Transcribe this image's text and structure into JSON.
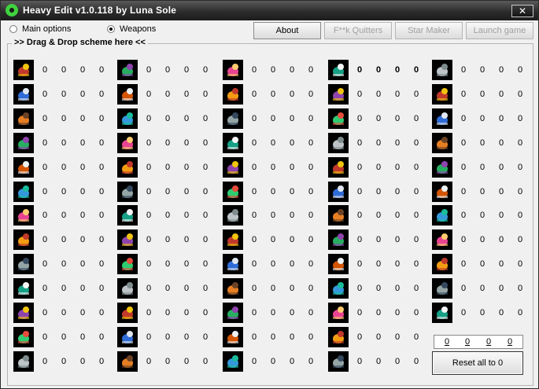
{
  "window": {
    "title": "Heavy Edit v1.0.118 by Luna Sole",
    "close_label": "✕"
  },
  "options": [
    {
      "label": "Main options",
      "selected": false
    },
    {
      "label": "Weapons",
      "selected": true
    }
  ],
  "toolbar": [
    {
      "label": "About",
      "enabled": true
    },
    {
      "label": "F**k Quitters",
      "enabled": false
    },
    {
      "label": "Star Maker",
      "enabled": false
    },
    {
      "label": "Launch game",
      "enabled": false
    }
  ],
  "group_label": ">> Drag & Drop scheme here <<",
  "columns": [
    {
      "rows": [
        {
          "icon": "dynamite-icon",
          "values": [
            "0",
            "0",
            "0",
            "0"
          ]
        },
        {
          "icon": "rocket-jet-icon",
          "values": [
            "0",
            "0",
            "0",
            "0"
          ]
        },
        {
          "icon": "grenade-icon",
          "values": [
            "0",
            "0",
            "0",
            "0"
          ]
        },
        {
          "icon": "banana-bottle-icon",
          "values": [
            "0",
            "0",
            "0",
            "0"
          ]
        },
        {
          "icon": "holy-grenade-icon",
          "values": [
            "0",
            "0",
            "0",
            "0"
          ]
        },
        {
          "icon": "ninja-rope-icon",
          "values": [
            "0",
            "0",
            "0",
            "0"
          ]
        },
        {
          "icon": "petrol-bomb-icon",
          "values": [
            "0",
            "0",
            "0",
            "0"
          ]
        },
        {
          "icon": "banana-icon",
          "values": [
            "0",
            "0",
            "0",
            "0"
          ]
        },
        {
          "icon": "handgun-icon",
          "values": [
            "0",
            "0",
            "0",
            "0"
          ]
        },
        {
          "icon": "uzi-icon",
          "values": [
            "0",
            "0",
            "0",
            "0"
          ]
        },
        {
          "icon": "minigun-icon",
          "values": [
            "0",
            "0",
            "0",
            "0"
          ]
        },
        {
          "icon": "laser-gun-icon",
          "values": [
            "0",
            "0",
            "0",
            "0"
          ]
        },
        {
          "icon": "longbow-icon",
          "values": [
            "0",
            "0",
            "0",
            "0"
          ]
        }
      ]
    },
    {
      "rows": [
        {
          "icon": "missiles-icon",
          "values": [
            "0",
            "0",
            "0",
            "0"
          ]
        },
        {
          "icon": "fire-icon",
          "values": [
            "0",
            "0",
            "0",
            "0"
          ]
        },
        {
          "icon": "mine-icon",
          "values": [
            "0",
            "0",
            "0",
            "0"
          ]
        },
        {
          "icon": "worm-bandana-icon",
          "values": [
            "0",
            "0",
            "0",
            "0"
          ]
        },
        {
          "icon": "kamikaze-worm-icon",
          "values": [
            "0",
            "0",
            "0",
            "0"
          ]
        },
        {
          "icon": "explosion-icon",
          "values": [
            "0",
            "0",
            "0",
            "0"
          ]
        },
        {
          "icon": "sausage-icon",
          "values": [
            "0",
            "0",
            "0",
            "0"
          ]
        },
        {
          "icon": "axe-icon",
          "values": [
            "0",
            "0",
            "0",
            "0"
          ]
        },
        {
          "icon": "robot-icon",
          "values": [
            "0",
            "0",
            "0",
            "0"
          ]
        },
        {
          "icon": "drill-icon",
          "values": [
            "0",
            "0",
            "0",
            "0"
          ]
        },
        {
          "icon": "girder-icon",
          "values": [
            "0",
            "0",
            "0",
            "0"
          ]
        },
        {
          "icon": "coil-icon",
          "values": [
            "0",
            "0",
            "0",
            "0"
          ]
        },
        {
          "icon": "parachute-icon",
          "values": [
            "0",
            "0",
            "0",
            "0"
          ]
        }
      ]
    },
    {
      "rows": [
        {
          "icon": "bottle-worm-icon",
          "values": [
            "0",
            "0",
            "0",
            "0"
          ]
        },
        {
          "icon": "battery-icon",
          "values": [
            "0",
            "0",
            "0",
            "0"
          ]
        },
        {
          "icon": "dynamite-stick-icon",
          "values": [
            "0",
            "0",
            "0",
            "0"
          ]
        },
        {
          "icon": "sheep-icon",
          "values": [
            "0",
            "0",
            "0",
            "0"
          ]
        },
        {
          "icon": "blowtorch-icon",
          "values": [
            "0",
            "0",
            "0",
            "0"
          ]
        },
        {
          "icon": "firestorm-icon",
          "values": [
            "0",
            "0",
            "0",
            "0"
          ]
        },
        {
          "icon": "purple-bird-icon",
          "values": [
            "0",
            "0",
            "0",
            "0"
          ]
        },
        {
          "icon": "cow-icon",
          "values": [
            "0",
            "0",
            "0",
            "0"
          ]
        },
        {
          "icon": "potion-icon",
          "values": [
            "0",
            "0",
            "0",
            "0"
          ]
        },
        {
          "icon": "old-woman-icon",
          "values": [
            "0",
            "0",
            "0",
            "0"
          ]
        },
        {
          "icon": "cloud-angel-icon",
          "values": [
            "0",
            "0",
            "0",
            "0"
          ]
        },
        {
          "icon": "airplane-icon",
          "values": [
            "0",
            "0",
            "0",
            "0"
          ]
        },
        {
          "icon": "mole-icon",
          "values": [
            "0",
            "0",
            "0",
            "0"
          ]
        }
      ]
    },
    {
      "rows": [
        {
          "icon": "worm-icon",
          "values": [
            "0",
            "0",
            "0",
            "0"
          ],
          "bold": true
        },
        {
          "icon": "ring-icon",
          "values": [
            "0",
            "0",
            "0",
            "0"
          ]
        },
        {
          "icon": "crosshair-wheel-icon",
          "values": [
            "0",
            "0",
            "0",
            "0"
          ]
        },
        {
          "icon": "worm-face-icon",
          "values": [
            "0",
            "0",
            "0",
            "0"
          ]
        },
        {
          "icon": "ghost-worm-icon",
          "values": [
            "0",
            "0",
            "0",
            "0"
          ]
        },
        {
          "icon": "ice-cube-icon",
          "values": [
            "0",
            "0",
            "0",
            "0"
          ]
        },
        {
          "icon": "banana-bomb-icon",
          "values": [
            "0",
            "0",
            "0",
            "0"
          ]
        },
        {
          "icon": "green-worm-icon",
          "values": [
            "0",
            "0",
            "0",
            "0"
          ]
        },
        {
          "icon": "stripes-icon",
          "values": [
            "0",
            "0",
            "0",
            "0"
          ]
        },
        {
          "icon": "landscape-icon",
          "values": [
            "0",
            "0",
            "0",
            "0"
          ]
        },
        {
          "icon": "scales-icon",
          "values": [
            "0",
            "0",
            "0",
            "0"
          ]
        },
        {
          "icon": "vase-icon",
          "values": [
            "0",
            "0",
            "0",
            "0"
          ]
        },
        {
          "icon": "red-pipes-icon",
          "values": [
            "0",
            "0",
            "0",
            "0"
          ]
        }
      ]
    },
    {
      "rows": [
        {
          "icon": "bullet-icon",
          "values": [
            "0",
            "0",
            "0",
            "0"
          ]
        },
        {
          "icon": "castle-icon",
          "values": [
            "0",
            "0",
            "0",
            "0"
          ]
        },
        {
          "icon": "arrows-cycle-icon",
          "values": [
            "0",
            "0",
            "0",
            "0"
          ]
        },
        {
          "icon": "shield-ring-icon",
          "values": [
            "0",
            "0",
            "0",
            "0"
          ]
        },
        {
          "icon": "hands-icon",
          "values": [
            "0",
            "0",
            "0",
            "0"
          ]
        },
        {
          "icon": "bomb-icon",
          "values": [
            "0",
            "0",
            "0",
            "0"
          ]
        },
        {
          "icon": "donkey-icon",
          "values": [
            "0",
            "0",
            "0",
            "0"
          ]
        },
        {
          "icon": "worm-head-icon",
          "values": [
            "0",
            "0",
            "0",
            "0"
          ]
        },
        {
          "icon": "sheep-fleet-icon",
          "values": [
            "0",
            "0",
            "0",
            "0"
          ]
        },
        {
          "icon": "hovercraft-icon",
          "values": [
            "0",
            "0",
            "0",
            "0"
          ]
        },
        {
          "icon": "air-strike-icon",
          "values": [
            "0",
            "0",
            "0",
            "0"
          ]
        }
      ]
    }
  ],
  "totals": [
    "0",
    "0",
    "0",
    "0"
  ],
  "reset_label": "Reset all to 0"
}
